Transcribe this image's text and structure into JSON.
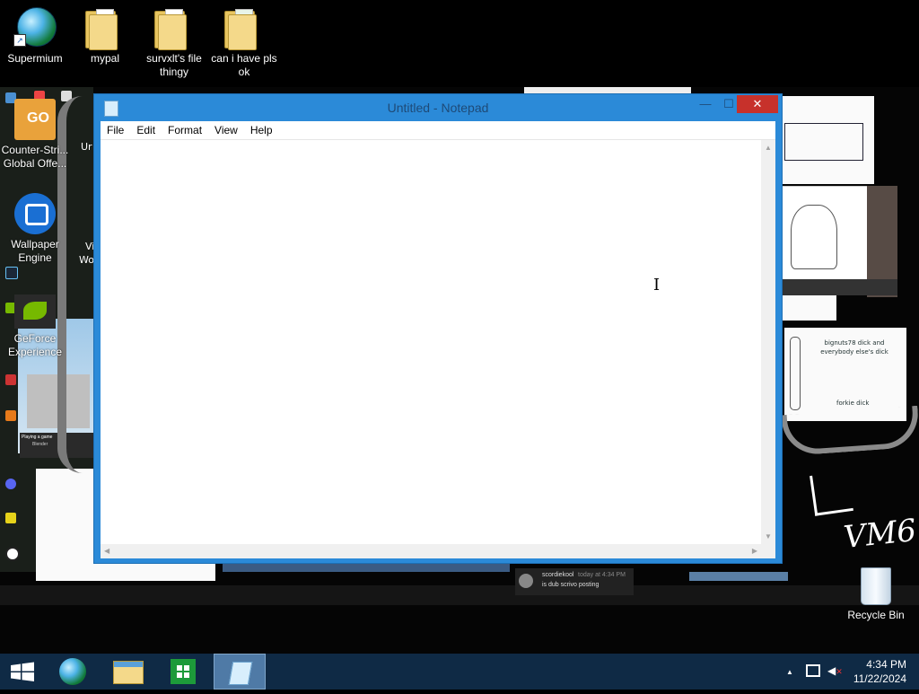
{
  "desktop": {
    "icons": [
      {
        "label": "Supermium",
        "icon": "supermium-browser-icon"
      },
      {
        "label": "mypal",
        "icon": "folder-icon"
      },
      {
        "label": "survxlt's file thingy",
        "icon": "folder-icon"
      },
      {
        "label": "can i have pls ok",
        "icon": "folder-icon"
      }
    ],
    "recycle_bin": {
      "label": "Recycle Bin",
      "icon": "recycle-bin-icon"
    }
  },
  "wallpaper": {
    "left_icons": [
      {
        "label": "Counter-Stri... Global Offe...",
        "icon": "csgo-icon"
      },
      {
        "label": "Wallpaper Engine",
        "icon": "wallpaper-engine-icon"
      },
      {
        "label": "GeForce Experience",
        "icon": "nvidia-icon"
      }
    ],
    "partial_labels": [
      "Ur",
      "Vi",
      "Wo"
    ],
    "go_badge": "GO",
    "sketch_text_1": "bignuts78 dick and everybody else's dick",
    "sketch_text_2": "forkie dick",
    "handwriting": "VM6",
    "notification": {
      "user": "scordiekool",
      "text": "is dub scrivo posting",
      "time": "today at 4:34 PM"
    },
    "steam_popup": {
      "title": "Playing a game",
      "app": "Blender"
    }
  },
  "notepad": {
    "title": "Untitled - Notepad",
    "menu": [
      "File",
      "Edit",
      "Format",
      "View",
      "Help"
    ],
    "content": "",
    "controls": {
      "minimize": "—",
      "maximize": "☐",
      "close": "✕"
    }
  },
  "taskbar": {
    "pinned": [
      {
        "icon": "start-windows-icon"
      },
      {
        "icon": "supermium-browser-icon"
      },
      {
        "icon": "file-explorer-icon"
      },
      {
        "icon": "store-icon"
      },
      {
        "icon": "notepad-icon",
        "active": true
      }
    ],
    "tray": {
      "up_arrow": "▲",
      "network": "network-icon",
      "volume": "volume-muted-icon"
    },
    "clock": {
      "time": "4:34 PM",
      "date": "11/22/2024"
    }
  },
  "colors": {
    "titlebar": "#2b8ad8",
    "close": "#c7312b",
    "taskbar": "#0f2a45"
  }
}
